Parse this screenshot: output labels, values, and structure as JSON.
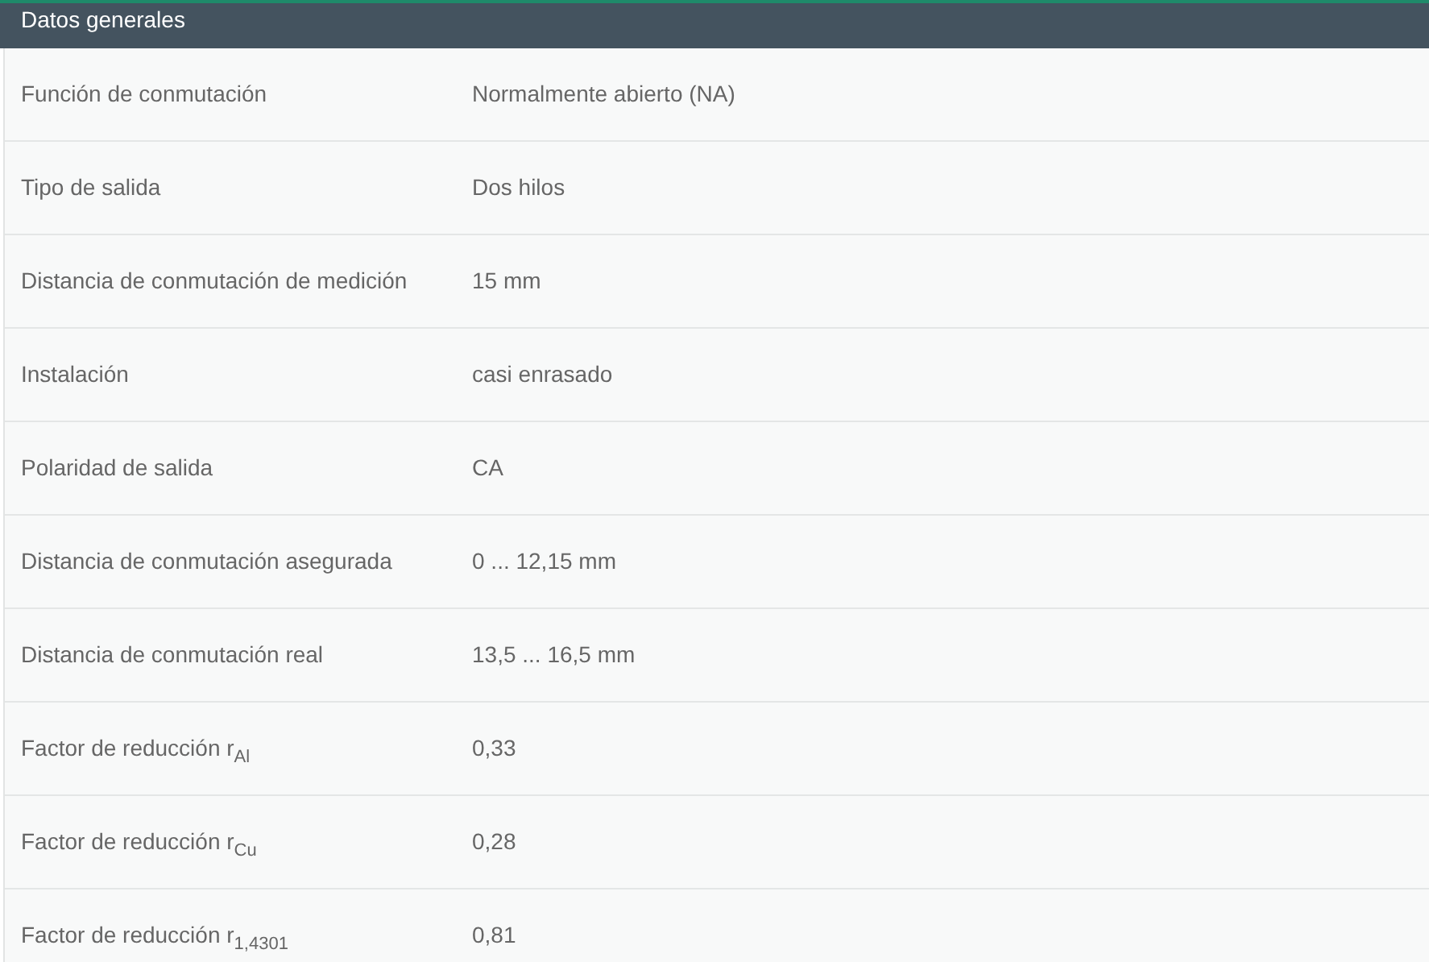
{
  "section": {
    "title": "Datos generales"
  },
  "rows": [
    {
      "label": "Función de conmutación",
      "value": "Normalmente abierto (NA)"
    },
    {
      "label": "Tipo de salida",
      "value": "Dos hilos"
    },
    {
      "label": "Distancia de conmutación de medición",
      "value": "15 mm"
    },
    {
      "label": "Instalación",
      "value": "casi enrasado"
    },
    {
      "label": "Polaridad de salida",
      "value": "CA"
    },
    {
      "label": "Distancia de conmutación asegurada",
      "value": "0 ... 12,15 mm"
    },
    {
      "label": "Distancia de conmutación real",
      "value": "13,5 ... 16,5 mm"
    },
    {
      "label": "Factor de reducción r$_{Al}$",
      "value": "0,33"
    },
    {
      "label": "Factor de reducción r$_{Cu}$",
      "value": "0,28"
    },
    {
      "label": "Factor de reducción r$_{1,4301}$",
      "value": "0,81"
    }
  ]
}
